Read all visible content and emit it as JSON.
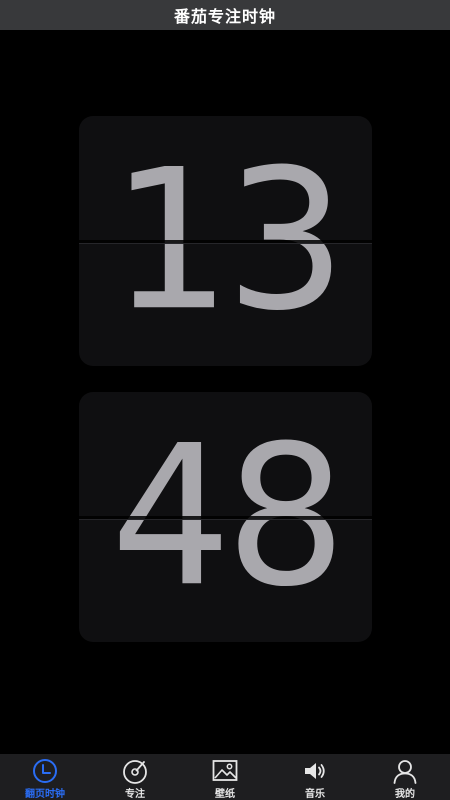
{
  "header": {
    "title": "番茄专注时钟"
  },
  "clock": {
    "hours": "13",
    "minutes": "48"
  },
  "colors": {
    "accent": "#2a6df4",
    "digits": "#a9a8ad",
    "card": "#0f0f11"
  },
  "tabbar": {
    "tabs": [
      {
        "label": "翻页时钟",
        "icon": "clock-icon",
        "active": true
      },
      {
        "label": "专注",
        "icon": "focus-disc-icon",
        "active": false
      },
      {
        "label": "壁纸",
        "icon": "image-icon",
        "active": false
      },
      {
        "label": "音乐",
        "icon": "speaker-icon",
        "active": false
      },
      {
        "label": "我的",
        "icon": "user-icon",
        "active": false
      }
    ]
  }
}
